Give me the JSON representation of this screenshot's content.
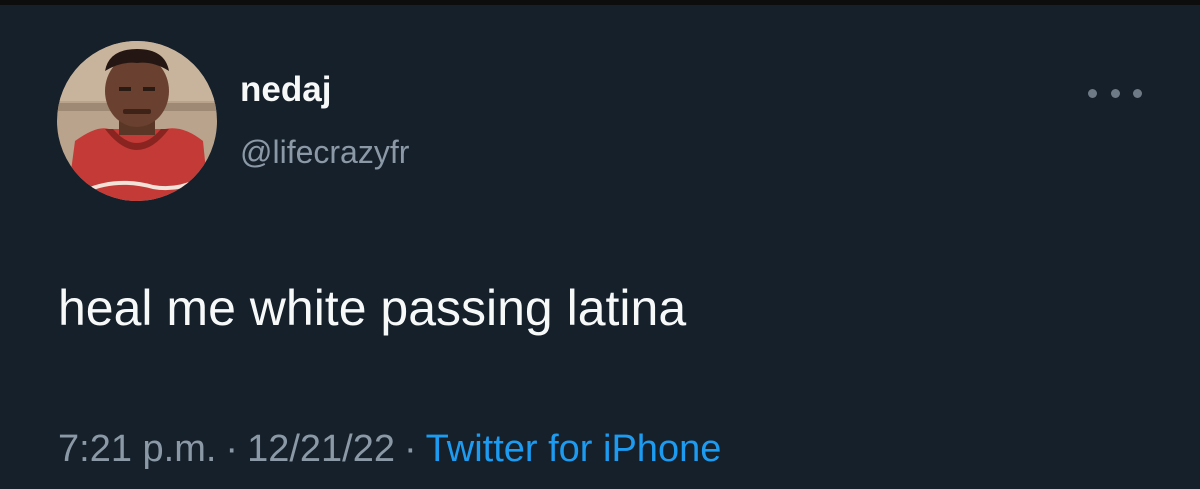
{
  "tweet": {
    "author": {
      "display_name": "nedaj",
      "handle": "@lifecrazyfr"
    },
    "more_icon": "more-horizontal-icon",
    "text": "heal me white passing latina",
    "time": "7:21 p.m.",
    "separator": "·",
    "date": "12/21/22",
    "source": "Twitter for iPhone"
  },
  "colors": {
    "background": "#15202b",
    "primary_text": "#f7f9f9",
    "secondary_text": "#8b98a5",
    "link": "#1d9bf0"
  }
}
